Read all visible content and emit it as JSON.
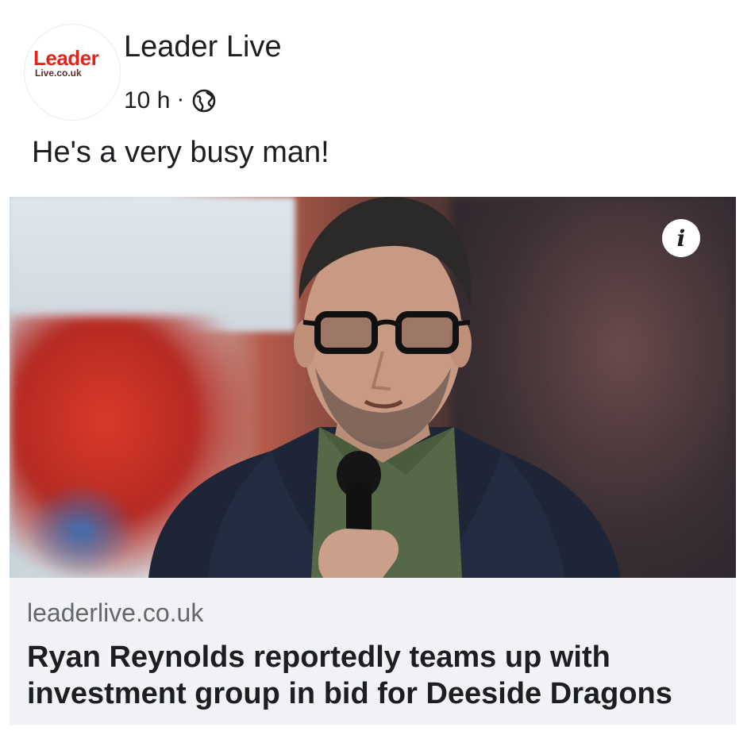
{
  "post": {
    "page_name": "Leader Live",
    "time": "10 h",
    "separator": "·",
    "privacy_icon": "globe-icon",
    "text": "He's a very busy man!"
  },
  "avatar": {
    "logo_line1": "Leader",
    "logo_line2": "Live.co.uk"
  },
  "image": {
    "info_label": "i",
    "info_icon": "info-icon"
  },
  "link_preview": {
    "domain": "leaderlive.co.uk",
    "title": "Ryan Reynolds reportedly teams up with investment group in bid for Deeside Dragons"
  },
  "colors": {
    "logo_red": "#e1251b",
    "link_box_bg": "#f0f2f5",
    "secondary_text": "#65676b"
  }
}
